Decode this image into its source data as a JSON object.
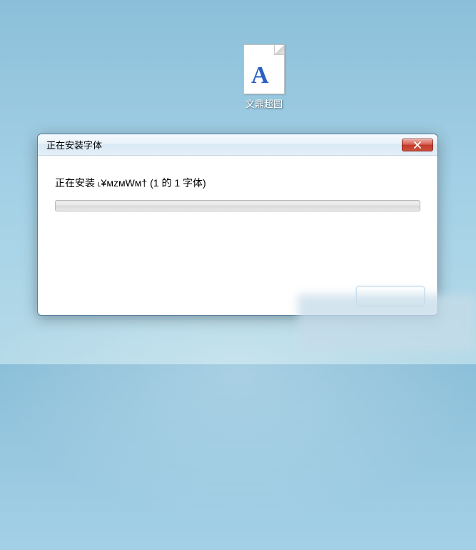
{
  "desktop": {
    "icon_letter": "A",
    "icon_label": "文鼎超圆"
  },
  "dialog": {
    "title": "正在安装字体",
    "message": "正在安装 ˪¥ᴍᴢᴍWᴍ† (1 的 1 字体)"
  }
}
